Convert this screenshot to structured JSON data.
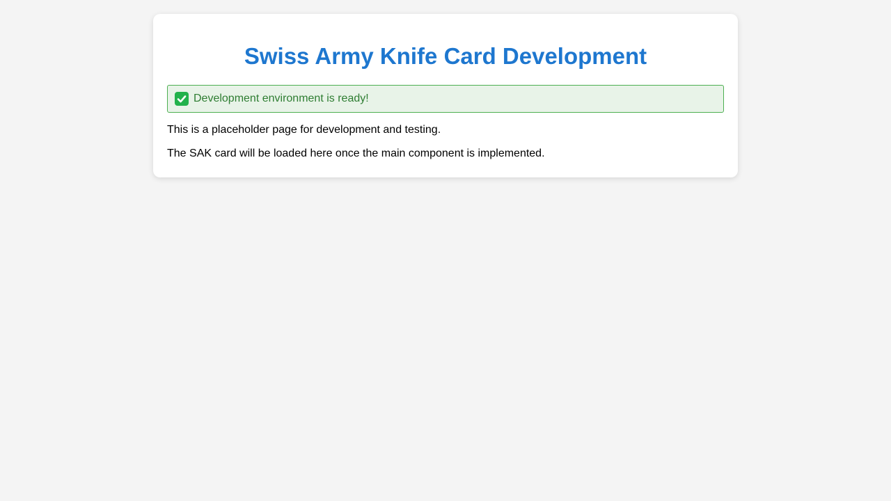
{
  "card": {
    "title": "Swiss Army Knife Card Development",
    "status": {
      "icon": "check-mark-icon",
      "text": "Development environment is ready!"
    },
    "paragraphs": [
      "This is a placeholder page for development and testing.",
      "The SAK card will be loaded here once the main component is implemented."
    ]
  },
  "colors": {
    "page_background": "#f4f4f4",
    "title": "#1e77cf",
    "status_border": "#4caf50",
    "status_background": "#e8f3e8",
    "status_text": "#2e7d32",
    "check_icon": "#22b24c"
  }
}
